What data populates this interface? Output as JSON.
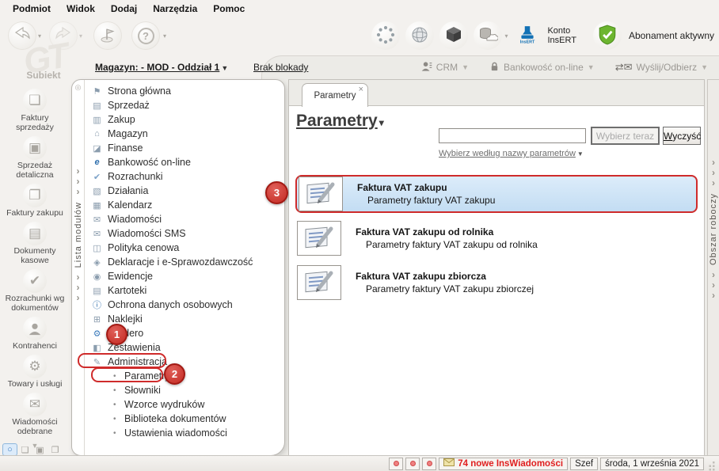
{
  "menubar": {
    "items": [
      "Podmiot",
      "Widok",
      "Dodaj",
      "Narzędzia",
      "Pomoc"
    ]
  },
  "toolbar": {
    "konto_stamp_text": "InsERT",
    "konto_line1": "Konto",
    "konto_line2": "InsERT",
    "abonament_label": "Abonament aktywny"
  },
  "workspace_bar": {
    "magazyn_label": "Magazyn: - MOD - Oddział 1",
    "lock_status": "Brak blokady",
    "crm_label": "CRM",
    "banking_label": "Bankowość on-line",
    "send_receive_label": "Wyślij/Odbierz"
  },
  "branding": {
    "logo": "GT",
    "app_name": "Subiekt"
  },
  "sidebar": {
    "items": [
      {
        "label": "Faktury sprzedaży",
        "glyph": "❏"
      },
      {
        "label": "Sprzedaż detaliczna",
        "glyph": "▣"
      },
      {
        "label": "Faktury zakupu",
        "glyph": "❐"
      },
      {
        "label": "Dokumenty kasowe",
        "glyph": "▤"
      },
      {
        "label": "Rozrachunki wg dokumentów",
        "glyph": "✔"
      },
      {
        "label": "Kontrahenci",
        "glyph": ""
      },
      {
        "label": "Towary i usługi",
        "glyph": "⚙"
      },
      {
        "label": "Wiadomości odebrane",
        "glyph": "✉"
      }
    ],
    "mini_icons": [
      "○",
      "❏",
      "▣",
      "❐",
      "◔",
      "⌂",
      "▤",
      "✎"
    ]
  },
  "module_tree": {
    "panel_label": "Lista modułów",
    "items": [
      {
        "label": "Strona główna",
        "glyph": "⚑"
      },
      {
        "label": "Sprzedaż",
        "glyph": "▤"
      },
      {
        "label": "Zakup",
        "glyph": "▥"
      },
      {
        "label": "Magazyn",
        "glyph": "⌂"
      },
      {
        "label": "Finanse",
        "glyph": "◪"
      },
      {
        "label": "Bankowość on-line",
        "glyph": "e"
      },
      {
        "label": "Rozrachunki",
        "glyph": "✔"
      },
      {
        "label": "Działania",
        "glyph": "▧"
      },
      {
        "label": "Kalendarz",
        "glyph": "▦"
      },
      {
        "label": "Wiadomości",
        "glyph": "✉"
      },
      {
        "label": "Wiadomości SMS",
        "glyph": "✉"
      },
      {
        "label": "Polityka cenowa",
        "glyph": "◫"
      },
      {
        "label": "Deklaracje i e-Sprawozdawczość",
        "glyph": "◈"
      },
      {
        "label": "Ewidencje",
        "glyph": "◉"
      },
      {
        "label": "Kartoteki",
        "glyph": "▤"
      },
      {
        "label": "Ochrona danych osobowych",
        "glyph": "ⓘ"
      },
      {
        "label": "Naklejki",
        "glyph": "⊞"
      },
      {
        "label": "vendero",
        "glyph": "⚙"
      },
      {
        "label": "Zestawienia",
        "glyph": "◧"
      },
      {
        "label": "Administracja",
        "glyph": "✎"
      }
    ],
    "admin_children": [
      "Parametry",
      "Słowniki",
      "Wzorce wydruków",
      "Biblioteka dokumentów",
      "Ustawienia wiadomości"
    ]
  },
  "main": {
    "tab_label": "Parametry",
    "title": "Parametry",
    "search_value": "",
    "select_button": "Wybierz teraz",
    "clear_button": "Wyczyść",
    "filter_link": "Wybierz według nazwy parametrów",
    "items": [
      {
        "title": "Faktura VAT zakupu",
        "subtitle": "Parametry faktury VAT zakupu"
      },
      {
        "title": "Faktura VAT zakupu od rolnika",
        "subtitle": "Parametry faktury VAT zakupu od rolnika"
      },
      {
        "title": "Faktura VAT zakupu zbiorcza",
        "subtitle": "Parametry faktury VAT zakupu zbiorczej"
      }
    ]
  },
  "right_panel": {
    "label": "Obszar roboczy"
  },
  "statusbar": {
    "messages_label": "74 nowe InsWiadomości",
    "user_label": "Szef",
    "date_label": "środa, 1 września 2021"
  },
  "annotations": {
    "step1": "1",
    "step2": "2",
    "step3": "3"
  },
  "icons": {
    "dropdown": "▾",
    "close": "×",
    "chevron": "›",
    "bullet": "•",
    "flag_help": "?",
    "collapse_more": "▼",
    "swap": "⇄",
    "mail": "✉",
    "strip_top": "◎"
  },
  "colors": {
    "annotation_red": "#cf2b2b",
    "selection_blue": "#c9e1f6",
    "alert_red": "#e01f1f",
    "brand_blue": "#1271b5",
    "shield_green": "#6cb52f"
  }
}
